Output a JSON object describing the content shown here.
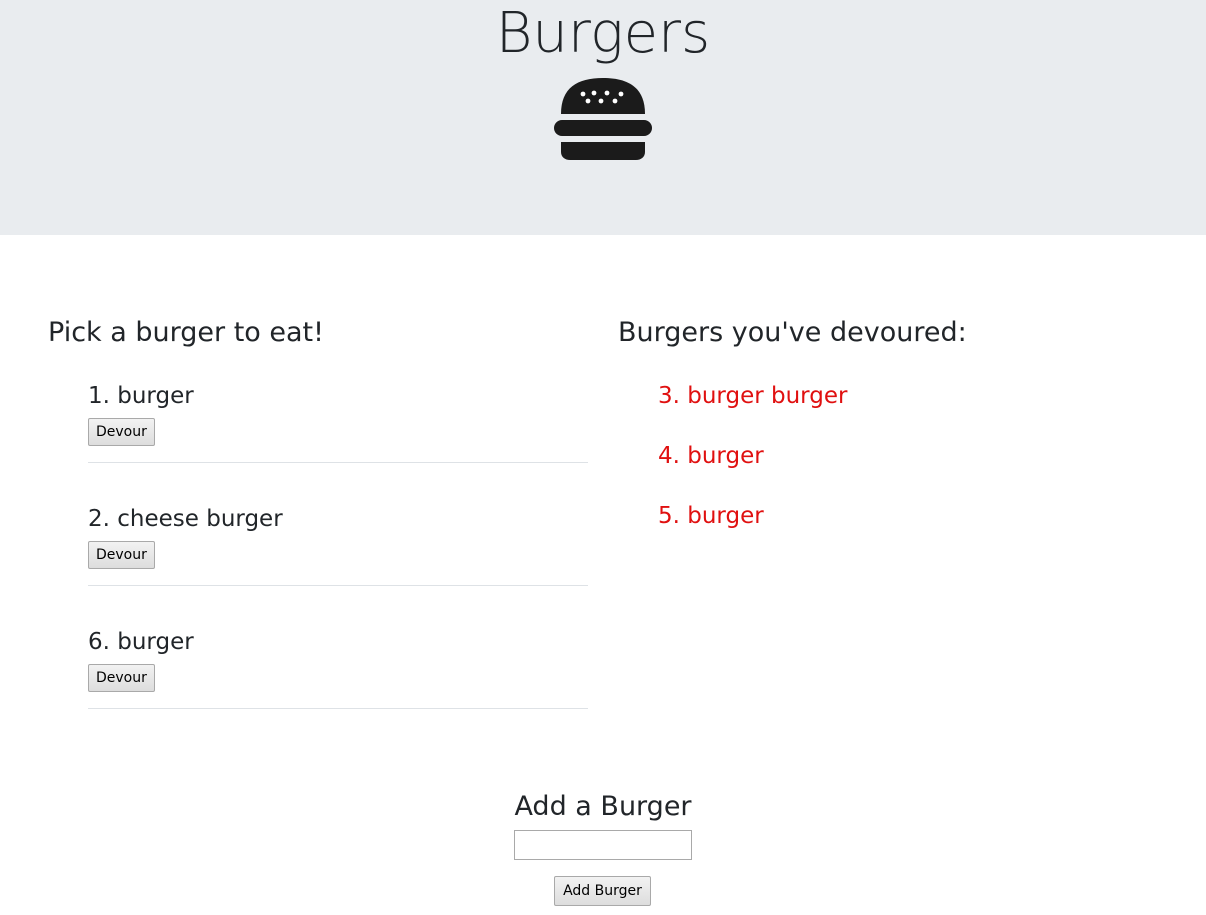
{
  "header": {
    "title": "Burgers",
    "logo_icon": "burger-icon"
  },
  "uneaten": {
    "heading": "Pick a burger to eat!",
    "items": [
      {
        "label": "1. burger",
        "button": "Devour"
      },
      {
        "label": "2. cheese burger",
        "button": "Devour"
      },
      {
        "label": "6. burger",
        "button": "Devour"
      }
    ]
  },
  "devoured": {
    "heading": "Burgers you've devoured:",
    "items": [
      {
        "label": "3. burger burger"
      },
      {
        "label": "4. burger"
      },
      {
        "label": "5. burger"
      }
    ]
  },
  "add_form": {
    "heading": "Add a Burger",
    "input_value": "",
    "input_placeholder": "",
    "button_label": "Add Burger"
  },
  "colors": {
    "jumbotron_bg": "#e9ecef",
    "devoured_text": "#e01010",
    "text": "#212529"
  }
}
